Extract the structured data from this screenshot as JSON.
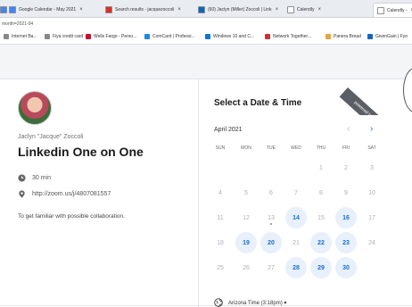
{
  "browser": {
    "tabs": [
      {
        "label": "",
        "color": "#4285f4"
      },
      {
        "label": "Google Calendar - May 2021",
        "color": "#4285f4"
      },
      {
        "label": "Search results - jacquezoccoli",
        "color": "#d93025"
      },
      {
        "label": "(60) Jaclyn (Miller) Zoccoli | Link",
        "color": "#0a66c2"
      },
      {
        "label": "Calendly",
        "color": "#ffffff"
      },
      {
        "label": "Calendly -",
        "color": "#ffffff"
      }
    ],
    "url": "month=2021-04",
    "bookmarks": [
      {
        "label": "Internet Ba...",
        "color": "#888888"
      },
      {
        "label": "Fiya credit card",
        "color": "#888888"
      },
      {
        "label": "Wells Fargo - Perso...",
        "color": "#c8102e"
      },
      {
        "label": "ComCard | Professi...",
        "color": "#1e88e5"
      },
      {
        "label": "Windows 10 and C...",
        "color": "#0078d7"
      },
      {
        "label": "Network Together...",
        "color": "#d32f2f"
      },
      {
        "label": "Panera Bread",
        "color": "#e8a33d"
      },
      {
        "label": "GivenGain | Fyo",
        "color": "#1565c0"
      }
    ]
  },
  "event": {
    "host": "Jaclyn \"Jacque\" Zoccoli",
    "title": "Linkedin One on One",
    "duration": "30 min",
    "location": "http://zoom.us/j/4807081557",
    "description": "To get familiar with possible collaboration."
  },
  "scheduler": {
    "title": "Select a Date & Time",
    "ribbon": "powered by Calendly",
    "month": "April 2021",
    "prev": "‹",
    "next": "›",
    "weekdays": [
      "SUN",
      "MON",
      "TUE",
      "WED",
      "THU",
      "FRI",
      "SAT"
    ],
    "weeks": [
      [
        "",
        "",
        "",
        "",
        "1",
        "2",
        "3"
      ],
      [
        "4",
        "5",
        "6",
        "7",
        "8",
        "9",
        "10"
      ],
      [
        "11",
        "12",
        "13",
        "14",
        "15",
        "16",
        "17"
      ],
      [
        "18",
        "19",
        "20",
        "21",
        "22",
        "23",
        "24"
      ],
      [
        "25",
        "26",
        "27",
        "28",
        "29",
        "30",
        ""
      ]
    ],
    "available": [
      "14",
      "16",
      "19",
      "20",
      "22",
      "23",
      "28",
      "29",
      "30"
    ],
    "today": "13",
    "timezone": "Arizona Time (3:18pm) ▾"
  }
}
